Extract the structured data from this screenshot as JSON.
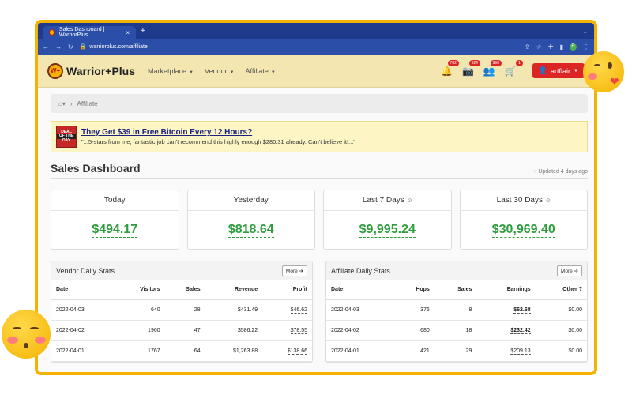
{
  "browser": {
    "tab_title": "Sales Dashboard | WarriorPlus",
    "tab_close": "×",
    "new_tab": "+",
    "url": "warriorplus.com/affiliate"
  },
  "site": {
    "logo_mark": "W+",
    "logo_text": "Warrior+Plus",
    "menu": [
      {
        "label": "Marketplace"
      },
      {
        "label": "Vendor"
      },
      {
        "label": "Affiliate"
      }
    ],
    "badges": {
      "bell": "702",
      "camera": "924",
      "users": "993",
      "cart": "1"
    },
    "user": "artflair"
  },
  "breadcrumb": {
    "current": "Affiliate"
  },
  "banner": {
    "deal_top": "DEAL",
    "deal_mid": "OF THE",
    "deal_bottom": "DAY",
    "headline": "They Get $39 in Free Bitcoin Every 12 Hours?",
    "quote": "\"...5-stars from me, fantastic job can't recommend this highly enough $280.31 already. Can't believe it!...\""
  },
  "page": {
    "title": "Sales Dashboard",
    "updated": "Updated 4 days ago"
  },
  "cards": [
    {
      "label": "Today",
      "value": "$494.17"
    },
    {
      "label": "Yesterday",
      "value": "$818.64"
    },
    {
      "label": "Last 7 Days",
      "value": "$9,995.24"
    },
    {
      "label": "Last 30 Days",
      "value": "$30,969.40"
    }
  ],
  "vendor_stats": {
    "title": "Vendor Daily Stats",
    "more": "More",
    "headers": [
      "Date",
      "Visitors",
      "Sales",
      "Revenue",
      "Profit"
    ],
    "rows": [
      [
        "2022-04-03",
        "640",
        "28",
        "$431.49",
        "$46.62"
      ],
      [
        "2022-04-02",
        "1960",
        "47",
        "$586.22",
        "$78.55"
      ],
      [
        "2022-04-01",
        "1767",
        "64",
        "$1,263.88",
        "$138.66"
      ]
    ]
  },
  "affiliate_stats": {
    "title": "Affiliate Daily Stats",
    "more": "More",
    "headers": [
      "Date",
      "Hops",
      "Sales",
      "Earnings",
      "Other"
    ],
    "rows": [
      [
        "2022-04-03",
        "376",
        "8",
        "$62.68",
        "$0.00"
      ],
      [
        "2022-04-02",
        "680",
        "18",
        "$232.42",
        "$0.00"
      ],
      [
        "2022-04-01",
        "421",
        "29",
        "$209.13",
        "$0.00"
      ]
    ]
  },
  "colors": {
    "frame": "#f5b301",
    "chrome": "#1e3a8a",
    "nav": "#f3e6b1",
    "money": "#2e9d3d",
    "user_button": "#dc2626"
  }
}
